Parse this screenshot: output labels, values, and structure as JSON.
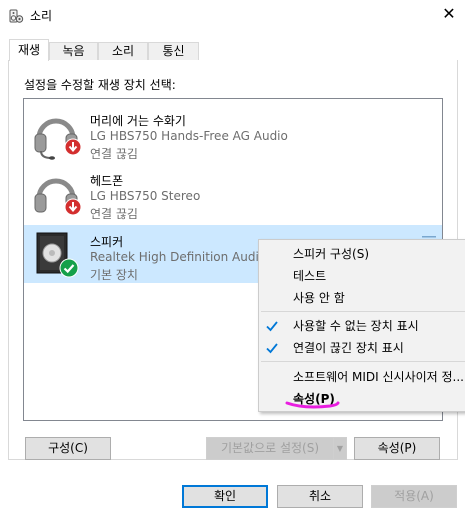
{
  "window": {
    "title": "소리",
    "close_glyph": "✕",
    "icon": "speaker-settings-icon"
  },
  "tabs": [
    {
      "label": "재생",
      "active": true
    },
    {
      "label": "녹음",
      "active": false
    },
    {
      "label": "소리",
      "active": false
    },
    {
      "label": "통신",
      "active": false
    }
  ],
  "panel": {
    "instruction": "설정을 수정할 재생 장치 선택:"
  },
  "devices": [
    {
      "name": "머리에 거는 수화기",
      "description": "LG HBS750 Hands-Free AG Audio",
      "status": "연결 끊김",
      "icon": "headset-icon",
      "badge": "disconnected-arrow-icon",
      "selected": false
    },
    {
      "name": "헤드폰",
      "description": "LG HBS750 Stereo",
      "status": "연결 끊김",
      "icon": "headphones-icon",
      "badge": "disconnected-arrow-icon",
      "selected": false
    },
    {
      "name": "스피커",
      "description": "Realtek High Definition Audio",
      "status": "기본 장치",
      "icon": "speaker-icon",
      "badge": "default-check-icon",
      "selected": true
    }
  ],
  "buttons": {
    "configure": "구성(C)",
    "set_default": "기본값으로 설정(S)",
    "properties": "속성(P)",
    "ok": "확인",
    "cancel": "취소",
    "apply": "적용(A)"
  },
  "context_menu": {
    "items": [
      {
        "label": "스피커 구성(S)",
        "checked": false,
        "bold": false
      },
      {
        "label": "테스트",
        "checked": false,
        "bold": false
      },
      {
        "label": "사용 안 함",
        "checked": false,
        "bold": false
      },
      {
        "label": "사용할 수 없는 장치 표시",
        "checked": true,
        "bold": false
      },
      {
        "label": "연결이 끊긴 장치 표시",
        "checked": true,
        "bold": false
      },
      {
        "label": "소프트웨어 MIDI 신시사이저 정...",
        "checked": false,
        "bold": false
      },
      {
        "label": "속성(P)",
        "checked": false,
        "bold": true
      }
    ]
  },
  "colors": {
    "selection": "#cce8ff",
    "accent": "#0078d7",
    "check": "#0078d7",
    "disconnect_badge": "#d32f2f",
    "default_badge": "#15a04a",
    "annotation": "#e91ee0"
  }
}
